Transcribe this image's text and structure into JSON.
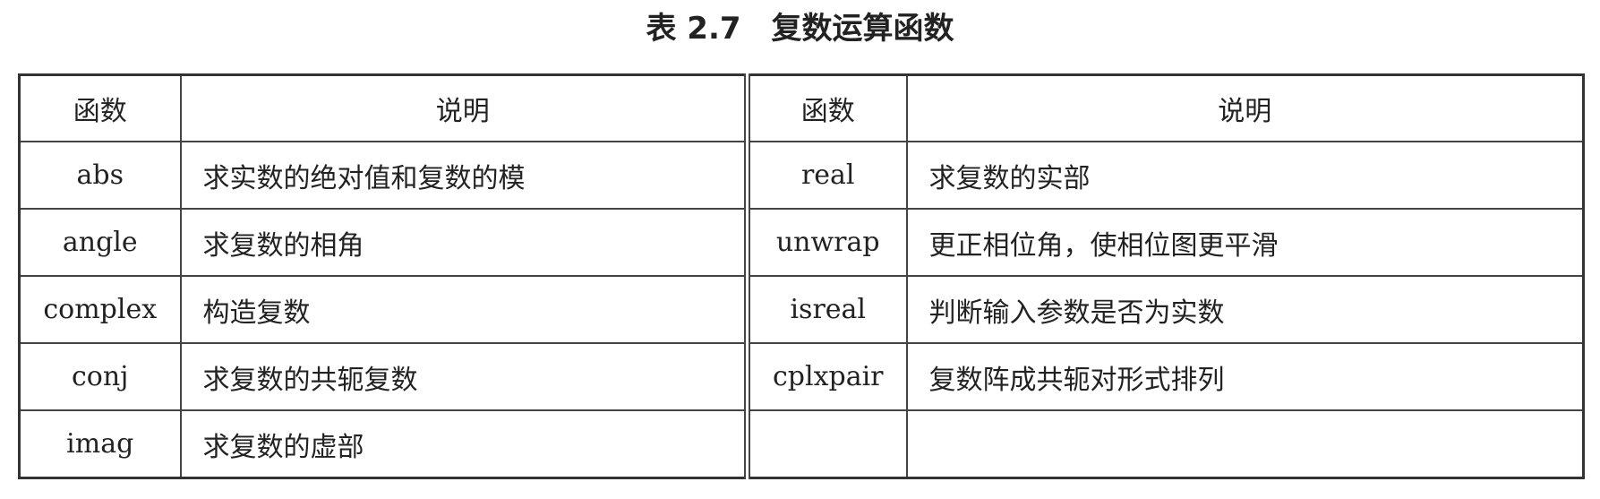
{
  "caption": {
    "number": "表 2.7",
    "title": "复数运算函数"
  },
  "headers": {
    "function": "函数",
    "description": "说明"
  },
  "rows": [
    {
      "left": {
        "name": "abs",
        "desc": "求实数的绝对值和复数的模"
      },
      "right": {
        "name": "real",
        "desc": "求复数的实部"
      }
    },
    {
      "left": {
        "name": "angle",
        "desc": "求复数的相角"
      },
      "right": {
        "name": "unwrap",
        "desc": "更正相位角，使相位图更平滑"
      }
    },
    {
      "left": {
        "name": "complex",
        "desc": "构造复数"
      },
      "right": {
        "name": "isreal",
        "desc": "判断输入参数是否为实数"
      }
    },
    {
      "left": {
        "name": "conj",
        "desc": "求复数的共轭复数"
      },
      "right": {
        "name": "cplxpair",
        "desc": "复数阵成共轭对形式排列"
      }
    },
    {
      "left": {
        "name": "imag",
        "desc": "求复数的虚部"
      },
      "right": {
        "name": "",
        "desc": ""
      }
    }
  ]
}
